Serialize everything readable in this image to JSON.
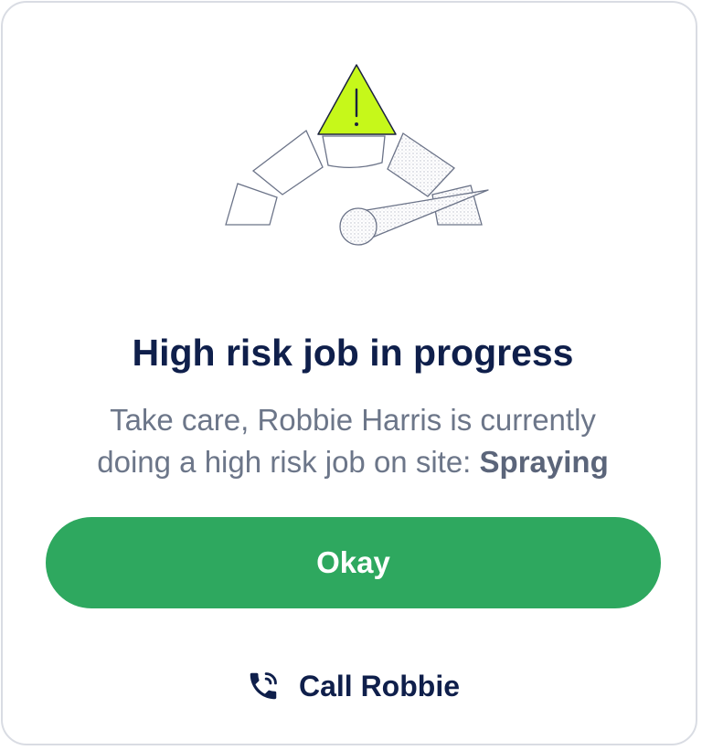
{
  "dialog": {
    "title": "High risk job in progress",
    "message_line1": "Take care, Robbie Harris is currently",
    "message_line2_prefix": "doing a high risk job on site:",
    "job_name": "Spraying",
    "primary_button_label": "Okay",
    "secondary_action_label": "Call Robbie"
  },
  "gauge": {
    "warning_icon": "warning-triangle-icon",
    "risk_level": "high"
  },
  "icons": {
    "call": "phone-call-icon"
  },
  "colors": {
    "accent_green": "#2ea85f",
    "warning_yellow": "#c6f81a",
    "title_navy": "#0f1f4b",
    "text_gray": "#6c7689"
  }
}
